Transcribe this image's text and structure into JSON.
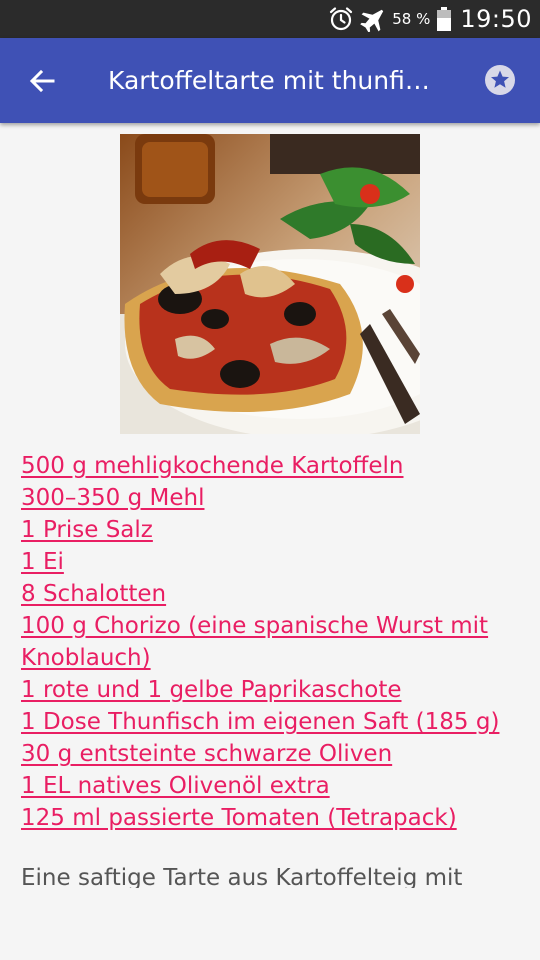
{
  "status_bar": {
    "battery_percent": "58 %",
    "time": "19:50",
    "icons": [
      "alarm-icon",
      "airplane-mode-icon",
      "battery-icon"
    ]
  },
  "app_bar": {
    "title": "Kartoffeltarte mit thunfi…",
    "back_icon": "arrow-left-icon",
    "favorite_icon": "star-icon"
  },
  "recipe": {
    "image": "food-photo",
    "ingredients": [
      "500 g mehligkochende Kartoffeln",
      "300–350 g Mehl",
      "1 Prise Salz",
      "1 Ei",
      "8 Schalotten",
      "100 g Chorizo (eine spanische Wurst mit Knoblauch)",
      "1 rote und 1 gelbe Paprikaschote",
      "1 Dose Thunfisch im eigenen Saft (185 g)",
      "30 g entsteinte schwarze Oliven",
      "1 EL natives Olivenöl extra",
      "125 ml passierte Tomaten (Tetrapack)"
    ],
    "description": "Eine saftige Tarte aus Kartoffelteig mit"
  },
  "colors": {
    "app_bar": "#3f51b5",
    "status_bar": "#2b2b2b",
    "link": "#e91e63",
    "background": "#f5f5f5"
  }
}
